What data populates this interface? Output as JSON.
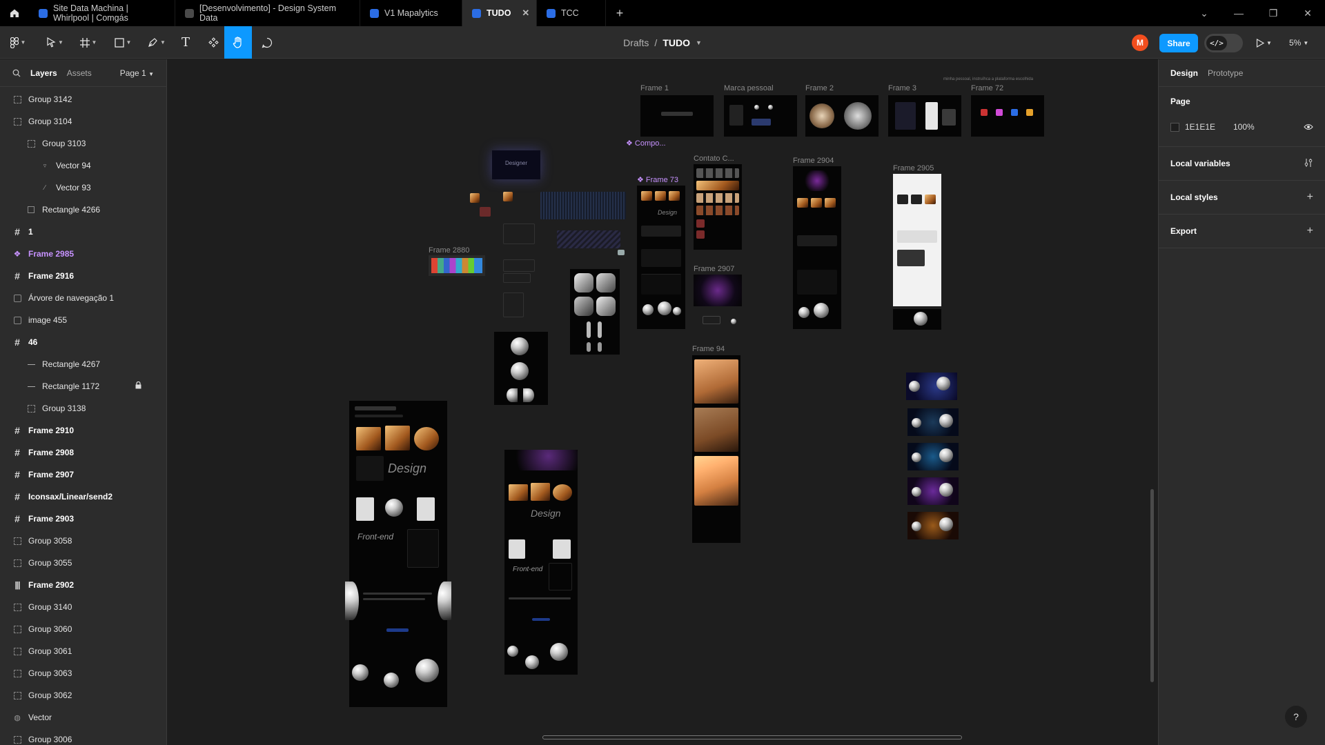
{
  "tabs": [
    {
      "label": "Site Data Machina | Whirlpool | Comgás",
      "active": false
    },
    {
      "label": "[Desenvolvimento] - Design System Data",
      "active": false
    },
    {
      "label": "V1 Mapalytics",
      "active": false
    },
    {
      "label": "TUDO",
      "active": true
    },
    {
      "label": "TCC",
      "active": false
    }
  ],
  "toolbar": {
    "breadcrumb_parent": "Drafts",
    "breadcrumb_sep": "/",
    "breadcrumb_current": "TUDO",
    "avatar_initial": "M",
    "share_label": "Share",
    "zoom_label": "5%"
  },
  "left_panel": {
    "tab_layers": "Layers",
    "tab_assets": "Assets",
    "page_label": "Page 1",
    "layers": [
      {
        "name": "Group 3142",
        "kind": "group",
        "indent": 0
      },
      {
        "name": "Group 3104",
        "kind": "group",
        "indent": 0
      },
      {
        "name": "Group 3103",
        "kind": "group",
        "indent": 1
      },
      {
        "name": "Vector 94",
        "kind": "vector",
        "indent": 2
      },
      {
        "name": "Vector 93",
        "kind": "vector-line",
        "indent": 2
      },
      {
        "name": "Rectangle 4266",
        "kind": "rect",
        "indent": 1
      },
      {
        "name": "1",
        "kind": "frame",
        "indent": 0
      },
      {
        "name": "Frame 2985",
        "kind": "component",
        "indent": 0
      },
      {
        "name": "Frame 2916",
        "kind": "frame",
        "indent": 0
      },
      {
        "name": "Árvore de navegação 1",
        "kind": "image",
        "indent": 0
      },
      {
        "name": "image 455",
        "kind": "image",
        "indent": 0
      },
      {
        "name": "46",
        "kind": "frame",
        "indent": 0
      },
      {
        "name": "Rectangle 4267",
        "kind": "line",
        "indent": 1
      },
      {
        "name": "Rectangle 1172",
        "kind": "line",
        "indent": 1,
        "locked": true
      },
      {
        "name": "Group 3138",
        "kind": "group",
        "indent": 1
      },
      {
        "name": "Frame 2910",
        "kind": "frame",
        "indent": 0
      },
      {
        "name": "Frame 2908",
        "kind": "frame",
        "indent": 0
      },
      {
        "name": "Frame 2907",
        "kind": "frame",
        "indent": 0
      },
      {
        "name": "Iconsax/Linear/send2",
        "kind": "frame",
        "indent": 0
      },
      {
        "name": "Frame 2903",
        "kind": "frame",
        "indent": 0
      },
      {
        "name": "Group 3058",
        "kind": "group",
        "indent": 0
      },
      {
        "name": "Group 3055",
        "kind": "group",
        "indent": 0
      },
      {
        "name": "Frame 2902",
        "kind": "frame-autolayout",
        "indent": 0
      },
      {
        "name": "Group 3140",
        "kind": "group",
        "indent": 0
      },
      {
        "name": "Group 3060",
        "kind": "group",
        "indent": 0
      },
      {
        "name": "Group 3061",
        "kind": "group",
        "indent": 0
      },
      {
        "name": "Group 3063",
        "kind": "group",
        "indent": 0
      },
      {
        "name": "Group 3062",
        "kind": "group",
        "indent": 0
      },
      {
        "name": "Vector",
        "kind": "vector-globe",
        "indent": 0
      },
      {
        "name": "Group 3006",
        "kind": "group",
        "indent": 0
      }
    ]
  },
  "canvas": {
    "labels": {
      "frame_1": "Frame 1",
      "marca_pessoal": "Marca pessoal",
      "frame_2": "Frame 2",
      "frame_3": "Frame 3",
      "frame_72": "Frame 72",
      "compo": "Compo...",
      "frame_73": "Frame 73",
      "contato": "Contato C...",
      "frame_2904": "Frame 2904",
      "frame_2905": "Frame 2905",
      "frame_2880": "Frame 2880",
      "frame_2907": "Frame 2907",
      "frame_94": "Frame 94",
      "top_note": "minha pessoal, instruíhca a plataforma escolhida",
      "designer_word": "Designer",
      "design_word": "Design",
      "frontend_word": "Front-end"
    }
  },
  "right_panel": {
    "tab_design": "Design",
    "tab_prototype": "Prototype",
    "page_title": "Page",
    "page_color": "1E1E1E",
    "page_opacity": "100%",
    "local_variables": "Local variables",
    "local_styles": "Local styles",
    "export": "Export"
  },
  "colors": {
    "accent": "#0d99ff",
    "component": "#c792ff",
    "avatar": "#f24e1e",
    "canvas_bg": "#1e1e1e",
    "panel_bg": "#2c2c2c"
  }
}
